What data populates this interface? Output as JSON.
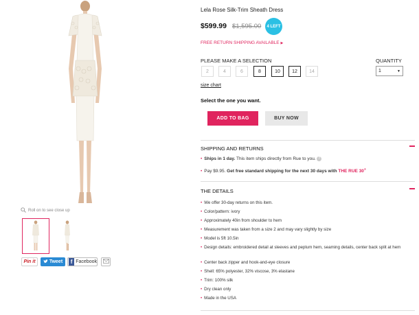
{
  "gallery": {
    "zoom_hint": "Roll on to see close up",
    "share": {
      "pin": "Pin it",
      "tweet": "Tweet",
      "facebook": "Facebook"
    }
  },
  "product": {
    "title": "Lela Rose Silk-Trim Sheath Dress",
    "price": "$599.99",
    "original_price": "$1,595.00",
    "stock_badge": "4 LEFT",
    "free_return": "FREE RETURN SHIPPING AVAILABLE"
  },
  "selection": {
    "heading": "PLEASE MAKE A SELECTION",
    "sizes": [
      {
        "label": "2",
        "available": false
      },
      {
        "label": "4",
        "available": false
      },
      {
        "label": "6",
        "available": false
      },
      {
        "label": "8",
        "available": true
      },
      {
        "label": "10",
        "available": true
      },
      {
        "label": "12",
        "available": true
      },
      {
        "label": "14",
        "available": false
      }
    ],
    "size_chart": "size chart",
    "quantity_heading": "QUANTITY",
    "quantity_value": "1",
    "prompt": "Select the one you want."
  },
  "actions": {
    "add_to_bag": "ADD TO BAG",
    "buy_now": "BUY NOW"
  },
  "shipping": {
    "heading": "SHIPPING AND RETURNS",
    "line1_bold": "Ships in 1 day.",
    "line1_rest": "This item ships directly from Rue to you.",
    "line2_pre": "Pay $9.95.",
    "line2_bold": "Get free standard shipping for the next 30 days with",
    "line2_brand": "THE RUE 30",
    "line2_sup": "®"
  },
  "details": {
    "heading": "THE DETAILS",
    "items": [
      "We offer 30-day returns on this item.",
      "Color/pattern: ivory",
      "Approximately 40in from shoulder to hem",
      "Measurement was taken from a size 2 and may vary slightly by size",
      "Model is 5ft 10.5in",
      "Design details: embroidered detail at sleeves and peplum hem, seaming details, center back split at hem",
      "Center back zipper and hook-and-eye closure",
      "Shell: 65% polyester, 32% viscose, 3% elastane",
      "Trim: 100% silk",
      "Dry clean only",
      "Made in the USA"
    ]
  },
  "colors": {
    "accent": "#e0245e",
    "badge": "#2bc0e4",
    "twitter": "#2a8ad4",
    "facebook": "#3b5998"
  }
}
